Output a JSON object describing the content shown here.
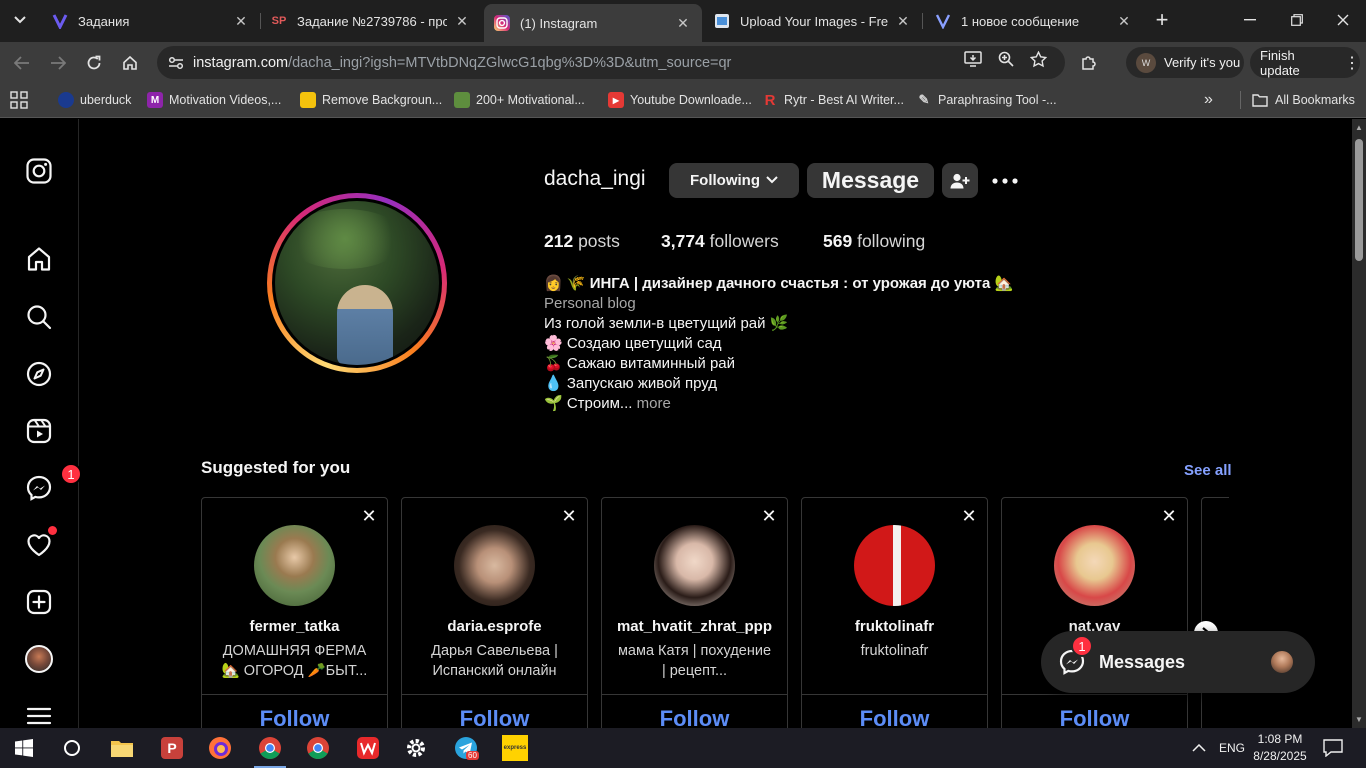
{
  "browser": {
    "tabs": [
      {
        "title": "Задания",
        "icon": "violet-v-icon",
        "active": false
      },
      {
        "title": "Задание №2739786 - прос",
        "icon": "sp-icon",
        "active": false
      },
      {
        "title": "(1) Instagram",
        "icon": "instagram-icon",
        "active": true
      },
      {
        "title": "Upload Your Images - Free I",
        "icon": "upload-icon",
        "active": false
      },
      {
        "title": "1 новое сообщение",
        "icon": "violet-v-icon",
        "active": false
      }
    ],
    "url_host": "instagram.com",
    "url_path": "/dacha_ingi?igsh=MTVtbDNqZGlwcG1qbg%3D%3D&utm_source=qr",
    "verify_label": "Verify it's you",
    "verify_avatar_letter": "W",
    "update_label": "Finish update",
    "bookmarks": [
      {
        "label": "uberduck",
        "icon": "uberduck-icon",
        "color": "#1a3a8f"
      },
      {
        "label": "Motivation Videos,...",
        "icon": "m-icon",
        "color": "#8e24aa"
      },
      {
        "label": "Remove Backgroun...",
        "icon": "remove-bg-icon",
        "color": "#f4c20d"
      },
      {
        "label": "200+ Motivational...",
        "icon": "shopify-icon",
        "color": "#5e8e3e"
      },
      {
        "label": "Youtube Downloade...",
        "icon": "youtube-icon",
        "color": "#e53935"
      },
      {
        "label": "Rytr - Best AI Writer...",
        "icon": "rytr-icon",
        "color": "#e53935"
      },
      {
        "label": "Paraphrasing Tool -...",
        "icon": "pen-icon",
        "color": "#cfcfcf"
      }
    ],
    "all_bookmarks_label": "All Bookmarks"
  },
  "profile": {
    "username": "dacha_ingi",
    "following_button": "Following",
    "message_button": "Message",
    "stats": {
      "posts_count": "212",
      "posts_label": "posts",
      "followers_count": "3,774",
      "followers_label": "followers",
      "following_count": "569",
      "following_label": "following"
    },
    "bio": {
      "full_name": "👩 🌾 ИНГА | дизайнер дачного счастья : от урожая до уюта 🏡",
      "category": "Personal blog",
      "lines": [
        "Из голой земли-в цветущий рай 🌿",
        "🌸 Создаю цветущий сад",
        "🍒 Сажаю витаминный рай",
        "💧 Запускаю живой пруд",
        "🌱 Строим..."
      ],
      "more_label": "more"
    }
  },
  "suggested": {
    "title": "Suggested for you",
    "see_all": "See all",
    "follow_label": "Follow",
    "cards": [
      {
        "username": "fermer_tatka",
        "description": "ДОМАШНЯЯ ФЕРМА 🏡 ОГОРОД 🥕БЫТ...",
        "avatar_color": "#6b8a55"
      },
      {
        "username": "daria.esprofe",
        "description": "Дарья Савельева | Испанский онлайн",
        "avatar_color": "#3a2a22"
      },
      {
        "username": "mat_hvatit_zhrat_ppp",
        "description": "мама Катя | похудение | рецепт...",
        "avatar_color": "#d9c8b8"
      },
      {
        "username": "fruktolinafr",
        "description": "fruktolinafr",
        "avatar_color": "#d11818"
      },
      {
        "username": "nat.vav",
        "description": "",
        "avatar_color": "#b9a28a"
      }
    ]
  },
  "messages": {
    "label": "Messages",
    "badge": "1"
  },
  "sidebar": {
    "messages_badge": "1"
  },
  "taskbar": {
    "language": "ENG",
    "time": "1:08 PM",
    "date": "8/28/2025",
    "telegram_badge": "60",
    "express_label": "express"
  }
}
